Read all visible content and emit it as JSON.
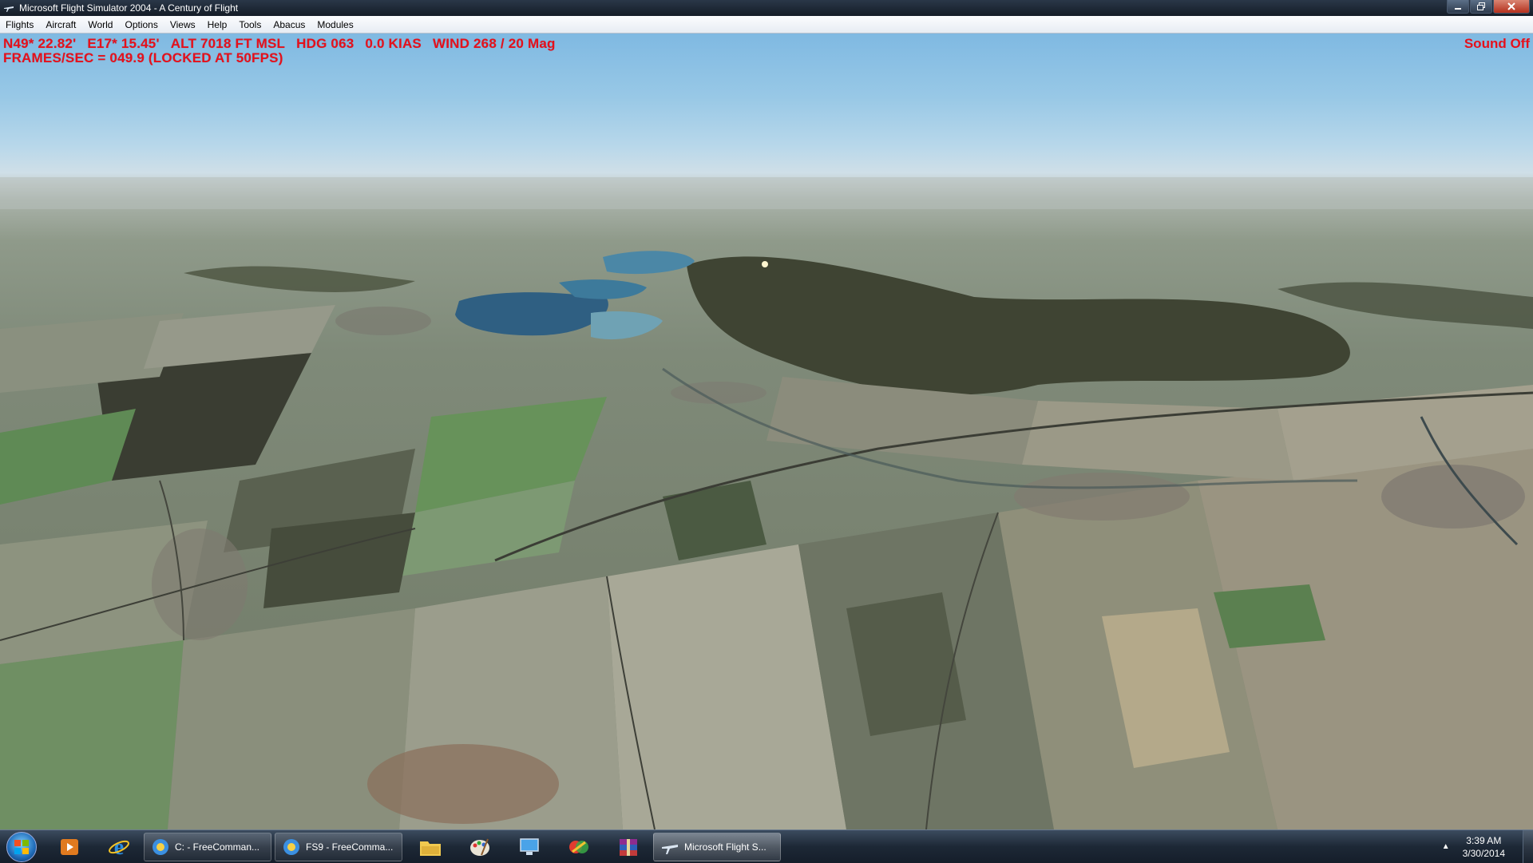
{
  "window": {
    "title": "Microsoft Flight Simulator 2004 - A Century of Flight",
    "icon": "airplane-icon",
    "controls": {
      "minimize_icon": "minimize-icon",
      "maximize_icon": "restore-icon",
      "close_icon": "close-icon"
    }
  },
  "menu": {
    "items": [
      "Flights",
      "Aircraft",
      "World",
      "Options",
      "Views",
      "Help",
      "Tools",
      "Abacus",
      "Modules"
    ]
  },
  "hud": {
    "lat": "N49* 22.82'",
    "lon": "E17* 15.45'",
    "alt": "ALT  7018 FT  MSL",
    "hdg": "HDG 063",
    "speed": "0.0 KIAS",
    "wind": "WIND 268 / 20 Mag",
    "frames": "FRAMES/SEC = 049.9 (LOCKED AT 50FPS)",
    "sound": "Sound Off",
    "color": "#e6101b"
  },
  "taskbar": {
    "start_icon": "windows-start-icon",
    "pinned": [
      {
        "icon": "media-player-icon"
      },
      {
        "icon": "internet-explorer-icon"
      }
    ],
    "tasks": [
      {
        "label": "C: - FreeComman...",
        "icon": "freecommander-icon"
      },
      {
        "label": "FS9 - FreeComma...",
        "icon": "freecommander-icon"
      }
    ],
    "pinned2": [
      {
        "icon": "file-explorer-icon"
      },
      {
        "icon": "paint-icon"
      },
      {
        "icon": "remote-desktop-icon"
      },
      {
        "icon": "colorful-app-icon"
      },
      {
        "icon": "winrar-icon"
      }
    ],
    "active_task": {
      "label": "Microsoft Flight S...",
      "icon": "airplane-icon"
    },
    "tray": {
      "arrow_icon": "show-hidden-icons-arrow",
      "time": "3:39 AM",
      "date": "3/30/2014"
    }
  }
}
